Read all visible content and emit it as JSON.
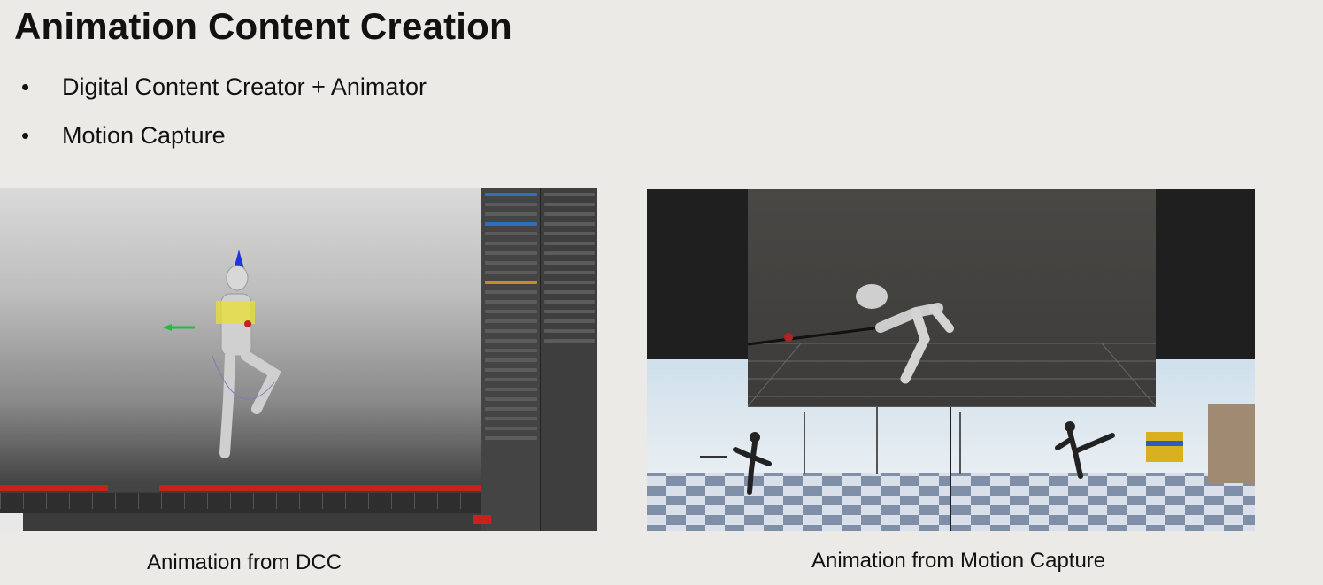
{
  "slide": {
    "title": "Animation Content Creation",
    "bullets": [
      "Digital Content Creator + Animator",
      "Motion Capture"
    ],
    "bullet_glyph": "•"
  },
  "figures": {
    "dcc_caption": "Animation from DCC",
    "mocap_caption": "Animation from Motion Capture"
  },
  "colors": {
    "background": "#ebeae6",
    "timeline_red": "#c9221b",
    "axis_blue": "#2233dd",
    "axis_green": "#22bb44",
    "rig_yellow": "#e8e030"
  }
}
